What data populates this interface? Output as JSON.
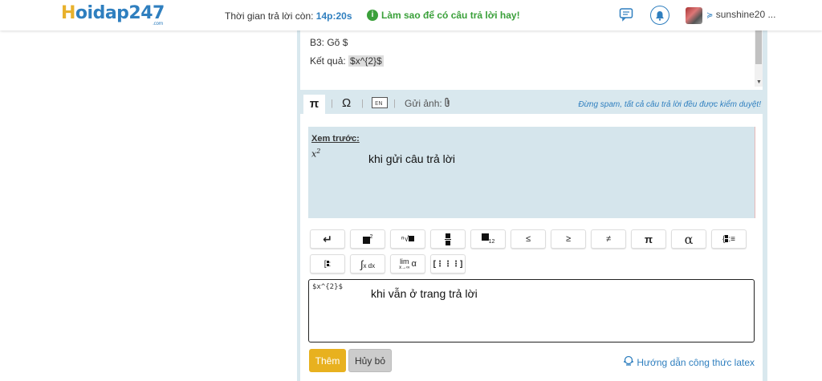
{
  "header": {
    "logo_h": "H",
    "logo_rest": "oidap247",
    "logo_sub": ".com",
    "timer_label": "Thời gian trả lời còn: ",
    "timer_value": "14p:20s",
    "howto_label": "Làm sao để có câu trả lời hay!",
    "username": "sunshine20 ...",
    "user_caret": "≽",
    "icons": {
      "chat": "chat-icon",
      "bell": "bell-icon",
      "info": "info-icon"
    }
  },
  "content": {
    "line_b3": "B3: Gõ $",
    "result_label": "Kết quả: ",
    "result_code": "$x^{2}$"
  },
  "toolbar": {
    "tab_pi": "π",
    "omega": "Ω",
    "en": "EN",
    "send_image": "Gửi ảnh:",
    "notice": "Đừng spam, tất cả câu trả lời đều được kiểm duyệt!"
  },
  "preview": {
    "title": "Xem trước:",
    "math_base": "x",
    "math_exp": "2",
    "note": "khi gửi câu trả lời"
  },
  "math_buttons": {
    "enter": "↵",
    "le": "≤",
    "ge": "≥",
    "ne": "≠",
    "pi": "π",
    "alpha": "α",
    "int_dx": "x dx",
    "lim": "lim",
    "lim_sub": "x→∞",
    "lim_alpha": "α",
    "matrix": "[⋮⋮⋮]"
  },
  "editor": {
    "code": "$x^{2}$",
    "note": "khi vẫn ở trang trả lời"
  },
  "actions": {
    "add": "Thêm",
    "cancel": "Hủy bỏ",
    "guide": "Hướng dẫn công thức latex"
  },
  "colors": {
    "brand_blue": "#2f7fbf",
    "brand_yellow": "#e8b12c",
    "howto_green": "#3aa03a",
    "panel_bg": "#d9e8ee"
  }
}
